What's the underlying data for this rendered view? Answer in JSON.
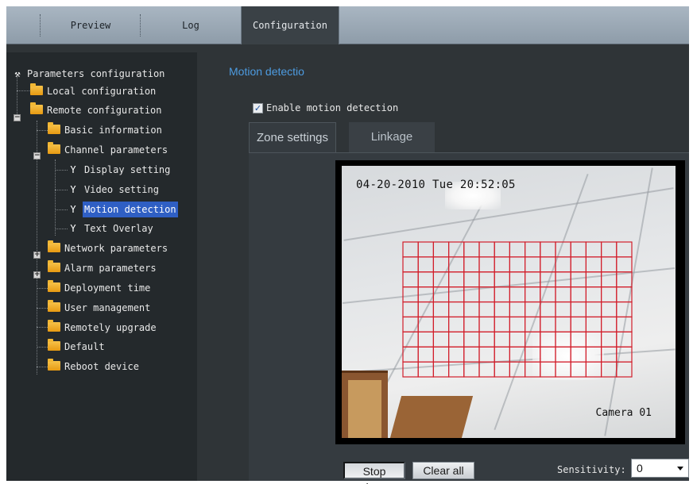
{
  "tabs": [
    {
      "label": "Preview"
    },
    {
      "label": "Log"
    },
    {
      "label": "Configuration",
      "active": true
    }
  ],
  "tree": {
    "root": "Parameters configuration",
    "items": [
      {
        "label": "Local configuration"
      },
      {
        "label": "Remote configuration"
      },
      {
        "label": "Basic information"
      },
      {
        "label": "Channel parameters"
      },
      {
        "label": "Display setting"
      },
      {
        "label": "Video setting"
      },
      {
        "label": "Motion detection",
        "selected": true
      },
      {
        "label": "Text Overlay"
      },
      {
        "label": "Network parameters"
      },
      {
        "label": "Alarm parameters"
      },
      {
        "label": "Deployment time"
      },
      {
        "label": "User management"
      },
      {
        "label": "Remotely upgrade"
      },
      {
        "label": "Default"
      },
      {
        "label": "Reboot device"
      }
    ]
  },
  "content": {
    "title": "Motion detectio",
    "enable_label": "Enable motion detection",
    "enable_checked": true,
    "subtabs": [
      {
        "label": "Zone settings",
        "active": true
      },
      {
        "label": "Linkage"
      }
    ],
    "video": {
      "timestamp": "04-20-2010 Tue 20:52:05",
      "camera_label": "Camera 01",
      "grid": {
        "cols": 15,
        "rows": 9,
        "color": "#d21e2b"
      }
    },
    "buttons": {
      "stop_draw": "Stop draw",
      "clear_all": "Clear all"
    },
    "sensitivity": {
      "label": "Sensitivity:",
      "value": "0"
    }
  },
  "colors": {
    "accent": "#4d9be0",
    "selection": "#2f5fc4",
    "folder": "#f0b030"
  }
}
